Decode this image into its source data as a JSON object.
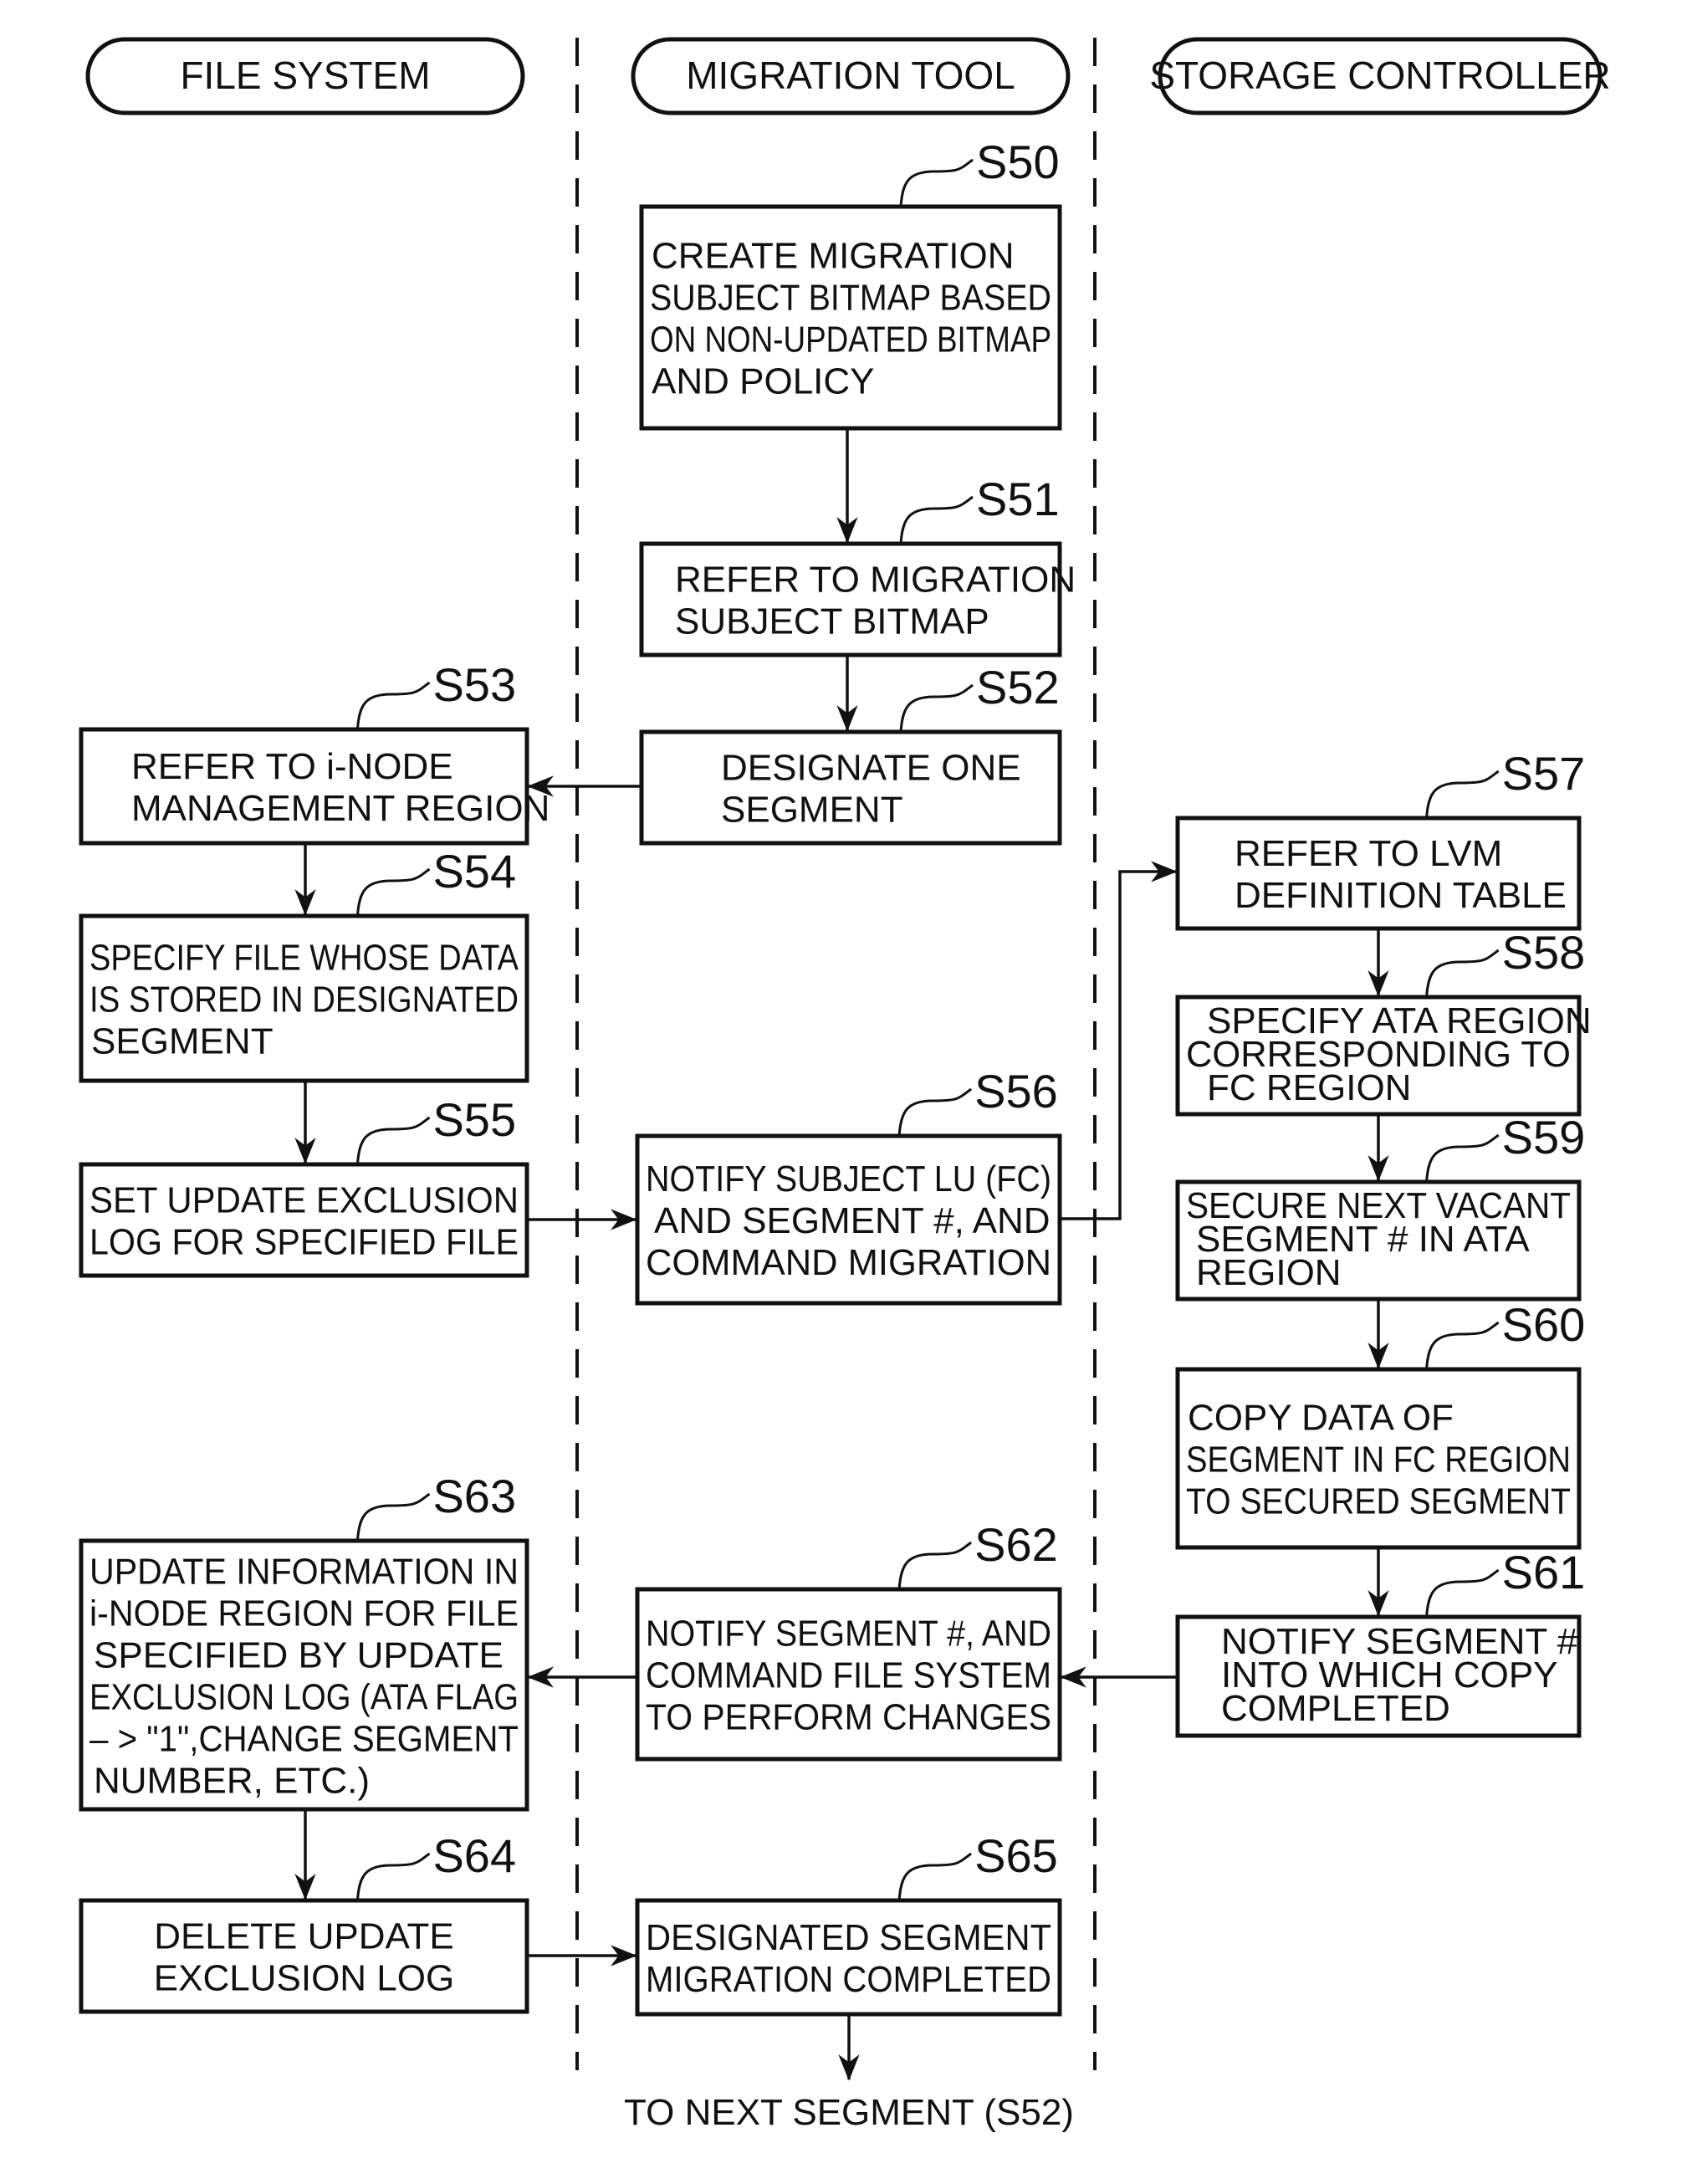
{
  "diagram": {
    "type": "swimlane-flowchart",
    "lanes": [
      {
        "id": "fs",
        "label": "FILE SYSTEM"
      },
      {
        "id": "mt",
        "label": "MIGRATION TOOL"
      },
      {
        "id": "sc",
        "label": "STORAGE CONTROLLER"
      }
    ],
    "steps": [
      {
        "id": "S50",
        "lane": "mt",
        "lines": [
          "CREATE MIGRATION",
          "SUBJECT BITMAP BASED",
          "ON NON-UPDATED BITMAP",
          "AND POLICY"
        ]
      },
      {
        "id": "S51",
        "lane": "mt",
        "lines": [
          "REFER TO MIGRATION",
          "SUBJECT BITMAP"
        ]
      },
      {
        "id": "S52",
        "lane": "mt",
        "lines": [
          "DESIGNATE ONE",
          "SEGMENT"
        ]
      },
      {
        "id": "S53",
        "lane": "fs",
        "lines": [
          "REFER TO i-NODE",
          "MANAGEMENT REGION"
        ]
      },
      {
        "id": "S54",
        "lane": "fs",
        "lines": [
          "SPECIFY FILE WHOSE DATA",
          "IS STORED IN DESIGNATED",
          "SEGMENT"
        ]
      },
      {
        "id": "S55",
        "lane": "fs",
        "lines": [
          "SET UPDATE EXCLUSION",
          "LOG FOR SPECIFIED FILE"
        ]
      },
      {
        "id": "S56",
        "lane": "mt",
        "lines": [
          "NOTIFY SUBJECT LU (FC)",
          "AND SEGMENT #, AND",
          "COMMAND MIGRATION"
        ]
      },
      {
        "id": "S57",
        "lane": "sc",
        "lines": [
          "REFER TO LVM",
          "DEFINITION TABLE"
        ]
      },
      {
        "id": "S58",
        "lane": "sc",
        "lines": [
          "SPECIFY ATA REGION",
          "CORRESPONDING TO",
          "FC REGION"
        ]
      },
      {
        "id": "S59",
        "lane": "sc",
        "lines": [
          "SECURE NEXT VACANT",
          "SEGMENT # IN ATA",
          "REGION"
        ]
      },
      {
        "id": "S60",
        "lane": "sc",
        "lines": [
          "COPY DATA OF",
          "SEGMENT IN FC REGION",
          "TO SECURED SEGMENT"
        ]
      },
      {
        "id": "S61",
        "lane": "sc",
        "lines": [
          "NOTIFY SEGMENT #",
          "INTO WHICH COPY",
          "COMPLETED"
        ]
      },
      {
        "id": "S62",
        "lane": "mt",
        "lines": [
          "NOTIFY SEGMENT #, AND",
          "COMMAND FILE SYSTEM",
          "TO PERFORM CHANGES"
        ]
      },
      {
        "id": "S63",
        "lane": "fs",
        "lines": [
          "UPDATE INFORMATION IN",
          "i-NODE REGION FOR FILE",
          "SPECIFIED BY UPDATE",
          "EXCLUSION LOG (ATA FLAG",
          "– > \"1\",CHANGE SEGMENT",
          "NUMBER, ETC.)"
        ]
      },
      {
        "id": "S64",
        "lane": "fs",
        "lines": [
          "DELETE UPDATE",
          "EXCLUSION LOG"
        ]
      },
      {
        "id": "S65",
        "lane": "mt",
        "lines": [
          "DESIGNATED SEGMENT",
          "MIGRATION COMPLETED"
        ]
      }
    ],
    "edges": [
      {
        "from": "S50",
        "to": "S51"
      },
      {
        "from": "S51",
        "to": "S52"
      },
      {
        "from": "S52",
        "to": "S53"
      },
      {
        "from": "S53",
        "to": "S54"
      },
      {
        "from": "S54",
        "to": "S55"
      },
      {
        "from": "S55",
        "to": "S56"
      },
      {
        "from": "S56",
        "to": "S57"
      },
      {
        "from": "S57",
        "to": "S58"
      },
      {
        "from": "S58",
        "to": "S59"
      },
      {
        "from": "S59",
        "to": "S60"
      },
      {
        "from": "S60",
        "to": "S61"
      },
      {
        "from": "S61",
        "to": "S62"
      },
      {
        "from": "S62",
        "to": "S63"
      },
      {
        "from": "S63",
        "to": "S64"
      },
      {
        "from": "S64",
        "to": "S65"
      },
      {
        "from": "S65",
        "to": "next"
      }
    ],
    "continuation_label": "TO NEXT SEGMENT (S52)"
  }
}
